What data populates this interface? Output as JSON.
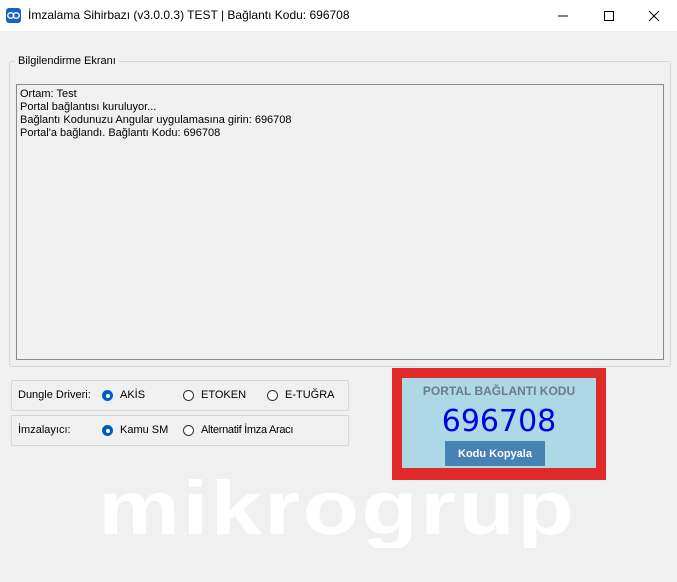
{
  "window": {
    "title": "İmzalama Sihirbazı (v3.0.0.3) TEST | Bağlantı Kodu: 696708"
  },
  "info_group": {
    "legend": "Bilgilendirme Ekranı",
    "log": [
      "Ortam: Test",
      "Portal bağlantısı kuruluyor...",
      "Bağlantı Kodunuzu Angular uygulamasına girin: 696708",
      "Portal'a bağlandı. Bağlantı Kodu: 696708"
    ]
  },
  "dongle": {
    "label": "Dungle Driveri:",
    "options": [
      "AKİS",
      "ETOKEN",
      "E-TUĞRA"
    ],
    "selected": "AKİS"
  },
  "signer": {
    "label": "İmzalayıcı:",
    "options": [
      "Kamu SM",
      "Alternatif İmza Aracı"
    ],
    "selected": "Kamu SM"
  },
  "portal": {
    "title": "PORTAL BAĞLANTI KODU",
    "code": "696708",
    "copy_button": "Kodu Kopyala"
  },
  "watermark": {
    "text": "mikrogrup"
  },
  "colors": {
    "portal_border": "#e02a2a",
    "portal_bg": "#add8e6",
    "code_text": "#0000e0",
    "button_bg": "#4682b4",
    "radio_selected": "#005fb8"
  },
  "icons": {
    "app": "link-icon",
    "minimize": "minimize-icon",
    "maximize": "maximize-icon",
    "close": "close-icon"
  }
}
